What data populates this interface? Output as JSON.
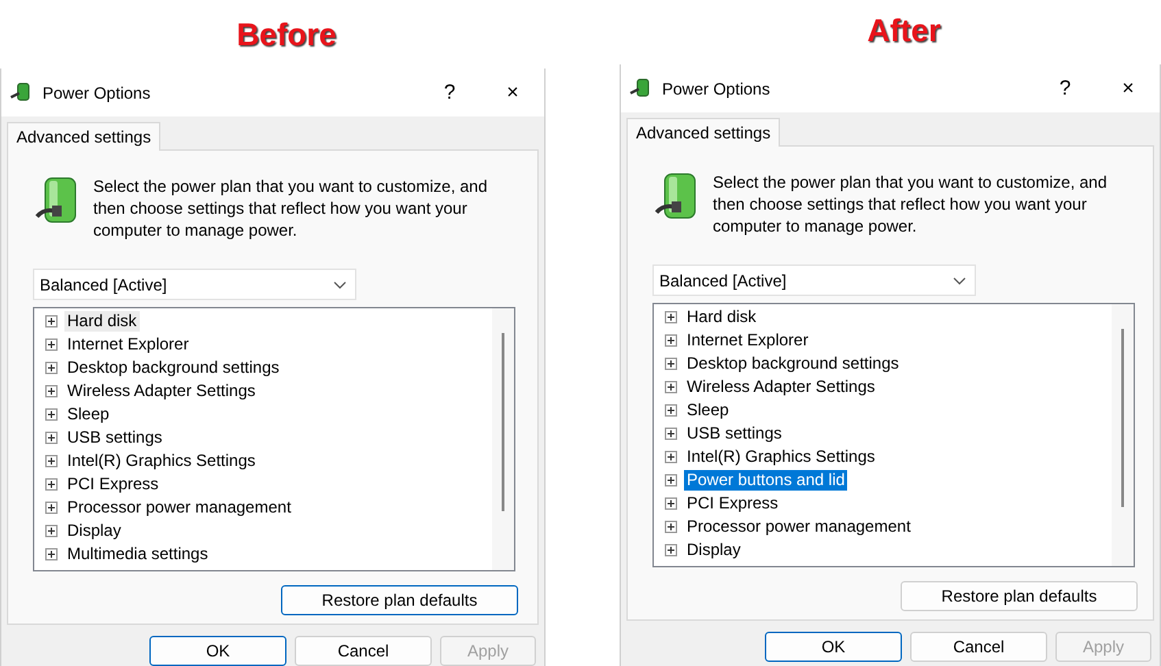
{
  "panels": [
    {
      "heading": "Before",
      "window": {
        "title": "Power Options",
        "help": "?",
        "close": "×"
      },
      "tab": {
        "label": "Advanced settings"
      },
      "description": "Select the power plan that you want to customize, and then choose settings that reflect how you want your computer to manage power.",
      "plan": "Balanced [Active]",
      "list_focused": false,
      "items": [
        {
          "label": "Hard disk",
          "selected": true
        },
        {
          "label": "Internet Explorer",
          "selected": false
        },
        {
          "label": "Desktop background settings",
          "selected": false
        },
        {
          "label": "Wireless Adapter Settings",
          "selected": false
        },
        {
          "label": "Sleep",
          "selected": false
        },
        {
          "label": "USB settings",
          "selected": false
        },
        {
          "label": "Intel(R) Graphics Settings",
          "selected": false
        },
        {
          "label": "PCI Express",
          "selected": false
        },
        {
          "label": "Processor power management",
          "selected": false
        },
        {
          "label": "Display",
          "selected": false
        },
        {
          "label": "Multimedia settings",
          "selected": false
        }
      ],
      "restore": {
        "label": "Restore plan defaults",
        "focused": true
      },
      "buttons": [
        {
          "label": "OK",
          "default": true,
          "disabled": false
        },
        {
          "label": "Cancel",
          "default": false,
          "disabled": false
        },
        {
          "label": "Apply",
          "default": false,
          "disabled": true
        }
      ]
    },
    {
      "heading": "After",
      "window": {
        "title": "Power Options",
        "help": "?",
        "close": "×"
      },
      "tab": {
        "label": "Advanced settings"
      },
      "description": "Select the power plan that you want to customize, and then choose settings that reflect how you want your computer to manage power.",
      "plan": "Balanced [Active]",
      "list_focused": true,
      "items": [
        {
          "label": "Hard disk",
          "selected": false
        },
        {
          "label": "Internet Explorer",
          "selected": false
        },
        {
          "label": "Desktop background settings",
          "selected": false
        },
        {
          "label": "Wireless Adapter Settings",
          "selected": false
        },
        {
          "label": "Sleep",
          "selected": false
        },
        {
          "label": "USB settings",
          "selected": false
        },
        {
          "label": "Intel(R) Graphics Settings",
          "selected": false
        },
        {
          "label": "Power buttons and lid",
          "selected": true
        },
        {
          "label": "PCI Express",
          "selected": false
        },
        {
          "label": "Processor power management",
          "selected": false
        },
        {
          "label": "Display",
          "selected": false
        }
      ],
      "restore": {
        "label": "Restore plan defaults",
        "focused": false
      },
      "buttons": [
        {
          "label": "OK",
          "default": true,
          "disabled": false
        },
        {
          "label": "Cancel",
          "default": false,
          "disabled": false
        },
        {
          "label": "Apply",
          "default": false,
          "disabled": true
        }
      ]
    }
  ]
}
